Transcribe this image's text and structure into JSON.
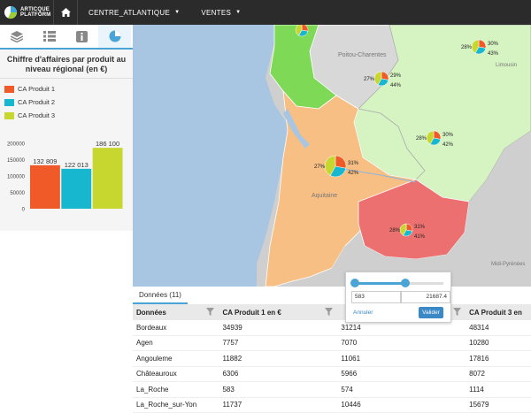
{
  "header": {
    "logo_line1": "ARTICQUE",
    "logo_line2": "PLATFORM",
    "menu_region": "CENTRE_ATLANTIQUE",
    "menu_sales": "VENTES"
  },
  "sidebar": {
    "panel_title": "Chiffre d'affaires par produit au niveau régional (en €)",
    "legend": [
      "CA Produit 1",
      "CA Produit 2",
      "CA Produit 3"
    ]
  },
  "chart_data": {
    "type": "bar",
    "categories": [
      "CA Produit 1",
      "CA Produit 2",
      "CA Produit 3"
    ],
    "values": [
      132809,
      122013,
      186100
    ],
    "value_labels": [
      "132 809",
      "122 013",
      "186 100"
    ],
    "colors": [
      "#f05a28",
      "#17b7d0",
      "#c8d630"
    ],
    "yticks": [
      "200000",
      "150000",
      "100000",
      "50000",
      "0"
    ],
    "ylim": [
      0,
      200000
    ]
  },
  "map": {
    "labels": {
      "poitou": "Poitou-Charentes",
      "limousin": "Limousin",
      "aquitaine": "Aquitaine",
      "midi_pyrenees": "Midi-Pyrénées"
    },
    "pies": [
      {
        "labels": [
          "",
          "",
          ""
        ]
      },
      {
        "labels": [
          "28%",
          "30%",
          "43%"
        ]
      },
      {
        "labels": [
          "27%",
          "29%",
          "44%"
        ]
      },
      {
        "labels": [
          "28%",
          "30%",
          "42%"
        ]
      },
      {
        "labels": [
          "27%",
          "31%",
          "42%"
        ]
      },
      {
        "labels": [
          "28%",
          "31%",
          "41%"
        ]
      }
    ]
  },
  "filter_popup": {
    "min_value": "583",
    "max_value": "21687.4",
    "cancel_label": "Annuler",
    "validate_label": "Valider"
  },
  "table": {
    "tab_label": "Données (11)",
    "columns": [
      "Données",
      "CA Produit 1 en €",
      "",
      "CA Produit 3 en"
    ],
    "rows": [
      [
        "Bordeaux",
        "34939",
        "31214",
        "48314"
      ],
      [
        "Agen",
        "7757",
        "7070",
        "10280"
      ],
      [
        "Angouleme",
        "11882",
        "11061",
        "17816"
      ],
      [
        "Châteauroux",
        "6306",
        "5966",
        "8072"
      ],
      [
        "La_Roche",
        "583",
        "574",
        "1114"
      ],
      [
        "La_Roche_sur-Yon",
        "11737",
        "10446",
        "15679"
      ]
    ]
  }
}
